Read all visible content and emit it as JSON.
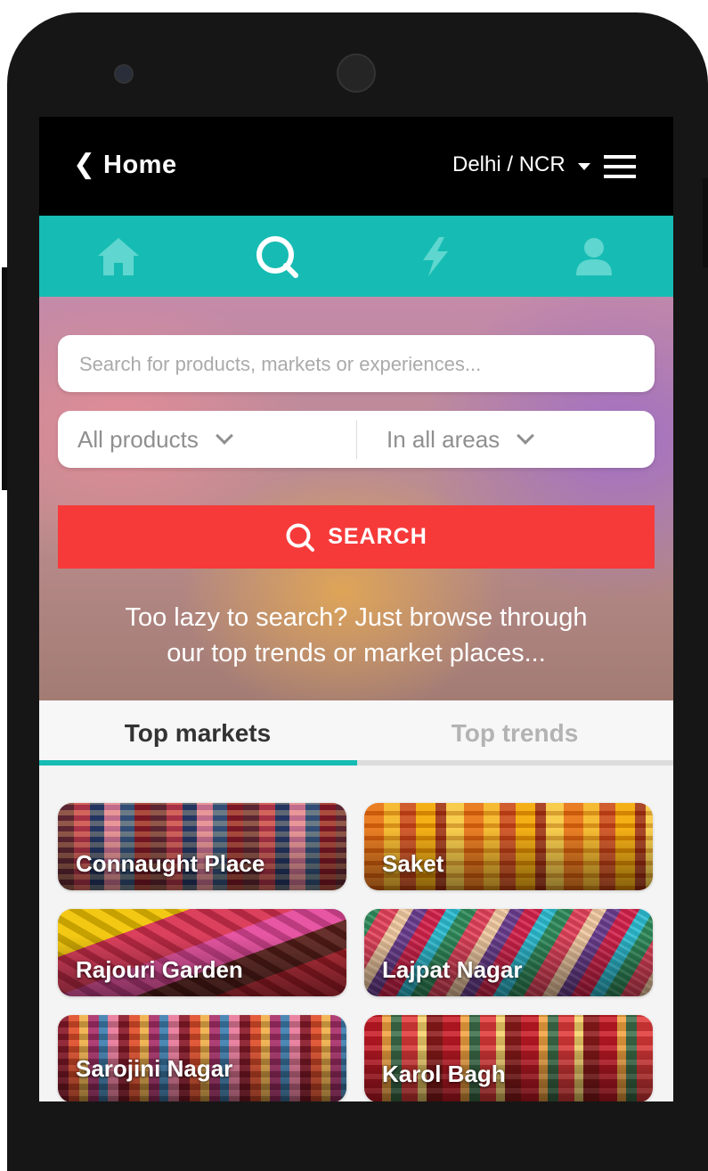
{
  "header": {
    "back_glyph": "❮",
    "title": "Home",
    "city": "Delhi / NCR",
    "city_caret_icon": "caret-down-icon",
    "menu_icon": "hamburger-menu-icon"
  },
  "nav": {
    "items": [
      {
        "icon": "home-icon",
        "active": false
      },
      {
        "icon": "search-icon",
        "active": true
      },
      {
        "icon": "lightning-icon",
        "active": false
      },
      {
        "icon": "user-icon",
        "active": false
      }
    ],
    "bg_color": "#16bcb3"
  },
  "search": {
    "placeholder": "Search for products, markets or experiences...",
    "value": ""
  },
  "filters": {
    "product": "All products",
    "area": "In all areas"
  },
  "search_button": {
    "label": "SEARCH",
    "color": "#f63a3a"
  },
  "hero": {
    "line1": "Too lazy to search? Just browse through",
    "line2": "our top trends or market places..."
  },
  "tabs": [
    {
      "label": "Top markets",
      "active": true
    },
    {
      "label": "Top trends",
      "active": false
    }
  ],
  "markets": [
    {
      "label": "Connaught Place"
    },
    {
      "label": "Saket"
    },
    {
      "label": "Rajouri Garden"
    },
    {
      "label": "Lajpat Nagar"
    },
    {
      "label": "Sarojini Nagar"
    },
    {
      "label": "Karol Bagh"
    }
  ]
}
